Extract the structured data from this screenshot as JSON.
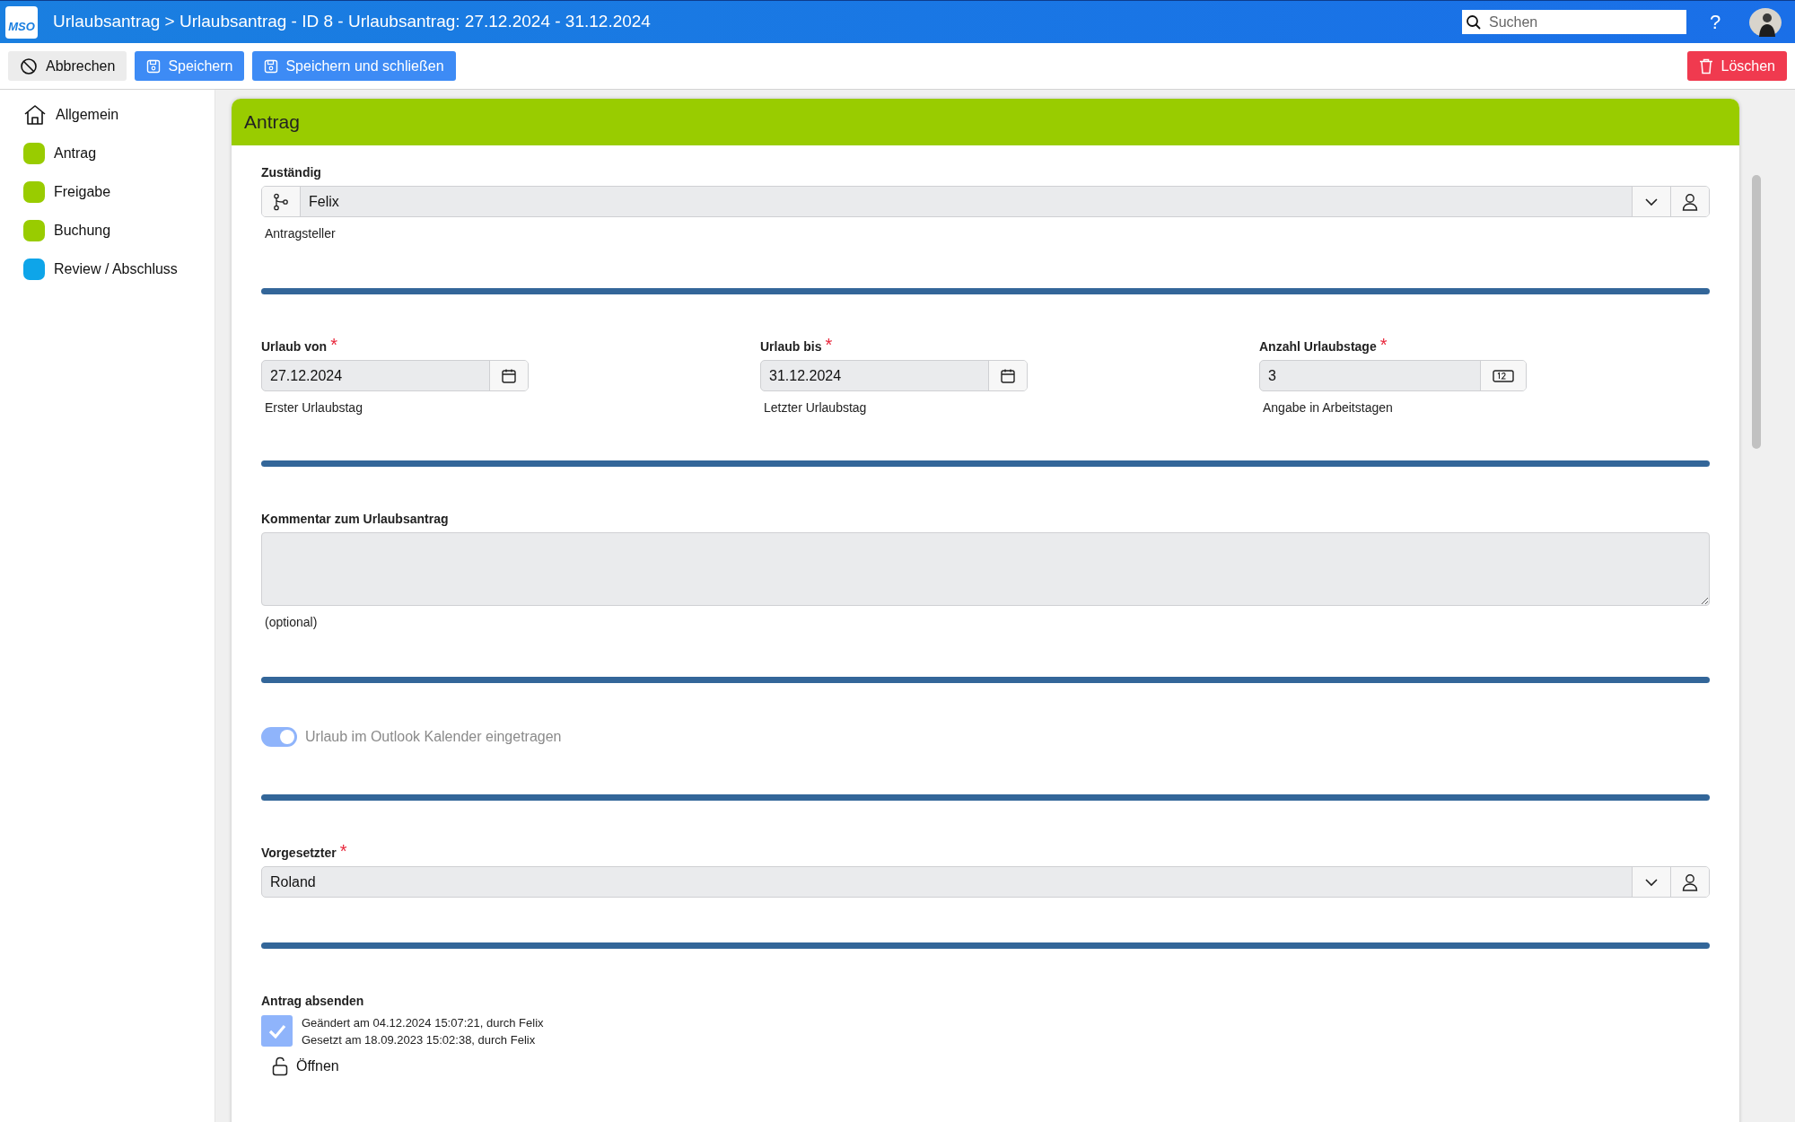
{
  "header": {
    "logo_text": "MSO",
    "title": "Urlaubsantrag > Urlaubsantrag - ID 8 - Urlaubsantrag: 27.12.2024 - 31.12.2024",
    "search": {
      "placeholder": "Suchen"
    },
    "help": "?"
  },
  "toolbar": {
    "buttons": [
      {
        "label": "Abbrechen",
        "kind": "cancel"
      },
      {
        "label": "Speichern",
        "kind": "save"
      },
      {
        "label": "Speichern und schließen",
        "kind": "save"
      },
      {
        "label": "Löschen",
        "kind": "delete"
      }
    ]
  },
  "sidebar": {
    "items": [
      {
        "label": "Allgemein",
        "kind": "home"
      },
      {
        "label": "Antrag",
        "kind": "status",
        "color": "#99cc00"
      },
      {
        "label": "Freigabe",
        "kind": "status",
        "color": "#99cc00"
      },
      {
        "label": "Buchung",
        "kind": "status",
        "color": "#99cc00"
      },
      {
        "label": "Review / Abschluss",
        "kind": "status",
        "color": "#0ea5e9"
      }
    ]
  },
  "card": {
    "title": "Antrag",
    "sections": [
      [
        {
          "kind": "workflow-select",
          "label": "Zuständig",
          "value": "Felix",
          "hint": "Antragsteller"
        }
      ],
      [
        {
          "kind": "date",
          "label": "Urlaub von",
          "required_mark": "*",
          "value": "27.12.2024",
          "hint": "Erster Urlaubstag"
        },
        {
          "kind": "date",
          "label": "Urlaub bis",
          "required_mark": "*",
          "value": "31.12.2024",
          "hint": "Letzter Urlaubstag"
        },
        {
          "kind": "number",
          "label": "Anzahl Urlaubstage",
          "required_mark": "*",
          "value": "3",
          "hint": "Angabe in Arbeitstagen"
        }
      ],
      [
        {
          "kind": "textarea",
          "label": "Kommentar zum Urlaubsantrag",
          "hint": "(optional)"
        }
      ],
      [
        {
          "kind": "toggle",
          "label": "Urlaub im Outlook Kalender eingetragen",
          "on": true,
          "disabled": true
        }
      ],
      [
        {
          "kind": "select",
          "label": "Vorgesetzter",
          "required_mark": "*",
          "value": "Roland"
        }
      ],
      [
        {
          "kind": "checkbox",
          "label": "Antrag absenden",
          "checked": true,
          "lines": [
            "Geändert am 04.12.2024 15:07:21, durch Felix",
            "Gesetzt am 18.09.2023 15:02:38, durch Felix"
          ],
          "action": "Öffnen"
        }
      ]
    ]
  }
}
